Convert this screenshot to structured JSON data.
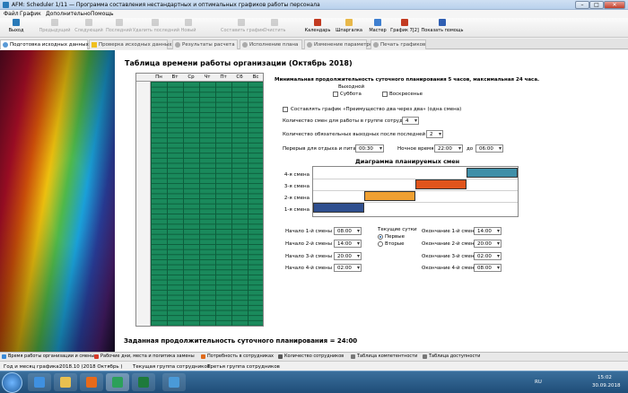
{
  "window": {
    "title": "AFM: Scheduler 1/11 — Программа составления нестандартных и оптимальных графиков работы персонала"
  },
  "menu": [
    "Файл",
    "График",
    "Дополнительно",
    "Помощь"
  ],
  "toolbar": [
    {
      "label": "Выход",
      "enabled": true,
      "icon": "exit-icon"
    },
    {
      "label": "Предыдущий",
      "enabled": false,
      "icon": "prev-icon"
    },
    {
      "label": "Следующий",
      "enabled": false,
      "icon": "next-icon"
    },
    {
      "label": "Последний",
      "enabled": false,
      "icon": "last-icon"
    },
    {
      "label": "Удалить последний",
      "enabled": false,
      "icon": "delete-icon"
    },
    {
      "label": "Новый",
      "enabled": false,
      "icon": "new-icon"
    },
    {
      "label": "Составить график",
      "enabled": false,
      "icon": "build-icon"
    },
    {
      "label": "Очистить",
      "enabled": false,
      "icon": "clear-icon"
    },
    {
      "label": "Календарь",
      "enabled": true,
      "icon": "calendar-icon"
    },
    {
      "label": "Шпаргалка",
      "enabled": true,
      "icon": "cheatsheet-icon"
    },
    {
      "label": "Мастер",
      "enabled": true,
      "icon": "wizard-icon"
    },
    {
      "label": "График 7[2]",
      "enabled": true,
      "icon": "schedule-icon"
    },
    {
      "label": "Показать помощь",
      "enabled": true,
      "icon": "help-icon"
    }
  ],
  "tabs": [
    "Подготовка исходных данных",
    "Проверка исходных данных",
    "Результаты расчета",
    "Исполнение плана",
    "Изменение параметров",
    "Печать графиков"
  ],
  "page": {
    "title": "Таблица времени работы организации (Октябрь 2018)",
    "min_max": "Минимальная продолжительность суточного планирования 5 часов, максимальная 24 часа.",
    "weekends_label": "Выходной",
    "saturday": "Суббота",
    "sunday": "Воскресенье",
    "two_days": "Составлять график «Преимущество два через два» (одна смена)",
    "shift_count_label": "Количество смен для работы в группе сотрудников",
    "shift_count": "4",
    "days_off_label": "Количество обязательных выходных после последней смены",
    "days_off": "2",
    "break_label": "Перерыв для отдыха и питания",
    "break_value": "00:30",
    "night_label": "Ночное время с",
    "night_from": "22:00",
    "night_to_label": "до",
    "night_to": "06:00",
    "diagram_title": "Диаграмма планируемых смен",
    "day_label": "Текущие сутки",
    "first": "Первые",
    "second": "Вторые",
    "footer": "Заданная продолжительность суточного планирования = 24:00"
  },
  "grid_days": [
    "Пн",
    "Вт",
    "Ср",
    "Чт",
    "Пт",
    "Сб",
    "Вс"
  ],
  "shifts": [
    {
      "start_label": "Начало 1-й смены",
      "start": "08:00",
      "end_label": "Окончание 1-й смены",
      "end": "14:00"
    },
    {
      "start_label": "Начало 2-й смены",
      "start": "14:00",
      "end_label": "Окончание 2-й смены",
      "end": "20:00"
    },
    {
      "start_label": "Начало 3-й смены",
      "start": "20:00",
      "end_label": "Окончание 3-й смены",
      "end": "02:00"
    },
    {
      "start_label": "Начало 4-й смены",
      "start": "02:00",
      "end_label": "Окончание 4-й смены",
      "end": "08:00"
    }
  ],
  "chart_data": {
    "type": "bar",
    "title": "Диаграмма планируемых смен",
    "categories": [
      "4-я смена",
      "3-я смена",
      "2-я смена",
      "1-я смена"
    ],
    "series": [
      {
        "values": [
          [
            18,
            24
          ],
          [
            12,
            18
          ],
          [
            6,
            12
          ],
          [
            0,
            6
          ]
        ]
      }
    ],
    "colors": [
      "#3f8fa8",
      "#e0541c",
      "#f0a032",
      "#2f4f8f"
    ]
  },
  "bottom_tabs": [
    "Время работы организации и смены",
    "Рабочие дни, места и политика замены",
    "Потребность в сотрудниках",
    "Количество сотрудников",
    "Таблица компетентности",
    "Таблица доступности"
  ],
  "status": {
    "month_label": "Год и месяц графика:",
    "month_value": "2018.10  (2018  Октябрь )",
    "group_label": "Текущая группа сотрудников:",
    "group_value": "Третья группа сотрудников"
  },
  "tray": {
    "lang": "RU",
    "time": "15:02",
    "date": "30.09.2018"
  }
}
